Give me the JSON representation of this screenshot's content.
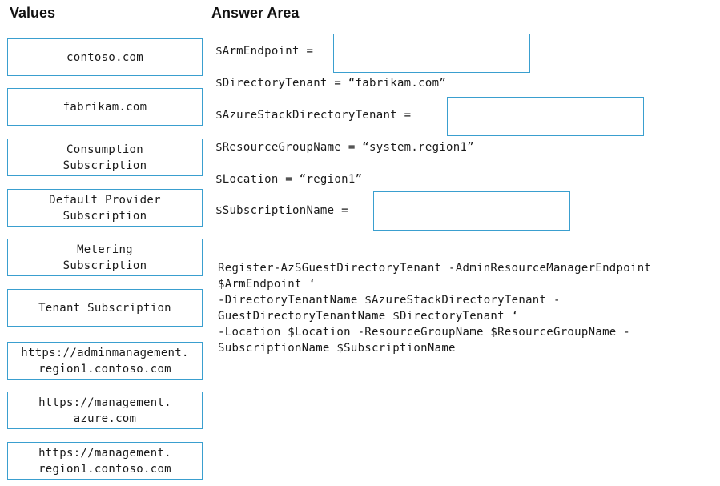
{
  "values": {
    "heading": "Values",
    "items": [
      "contoso.com",
      "fabrikam.com",
      "Consumption\nSubscription",
      "Default Provider\nSubscription",
      "Metering\nSubscription",
      "Tenant Subscription",
      "https://adminmanagement.\nregion1.contoso.com",
      "https://management.\nazure.com",
      "https://management.\nregion1.contoso.com"
    ]
  },
  "answer_area": {
    "heading": "Answer Area",
    "lines": {
      "arm_endpoint": "$ArmEndpoint =",
      "directory_tenant": "$DirectoryTenant = “fabrikam.com”",
      "azure_stack_directory_tenant": "$AzureStackDirectoryTenant =",
      "resource_group_name": "$ResourceGroupName = “system.region1”",
      "location": "$Location = “region1”",
      "subscription_name": "$SubscriptionName ="
    },
    "code": [
      "Register-AzSGuestDirectoryTenant -AdminResourceManagerEndpoint",
      "$ArmEndpoint ‘",
      "-DirectoryTenantName $AzureStackDirectoryTenant -",
      "GuestDirectoryTenantName $DirectoryTenant ‘",
      "-Location $Location -ResourceGroupName $ResourceGroupName -",
      "SubscriptionName $SubscriptionName"
    ]
  },
  "colors": {
    "tile_border": "#3a9fcf"
  }
}
